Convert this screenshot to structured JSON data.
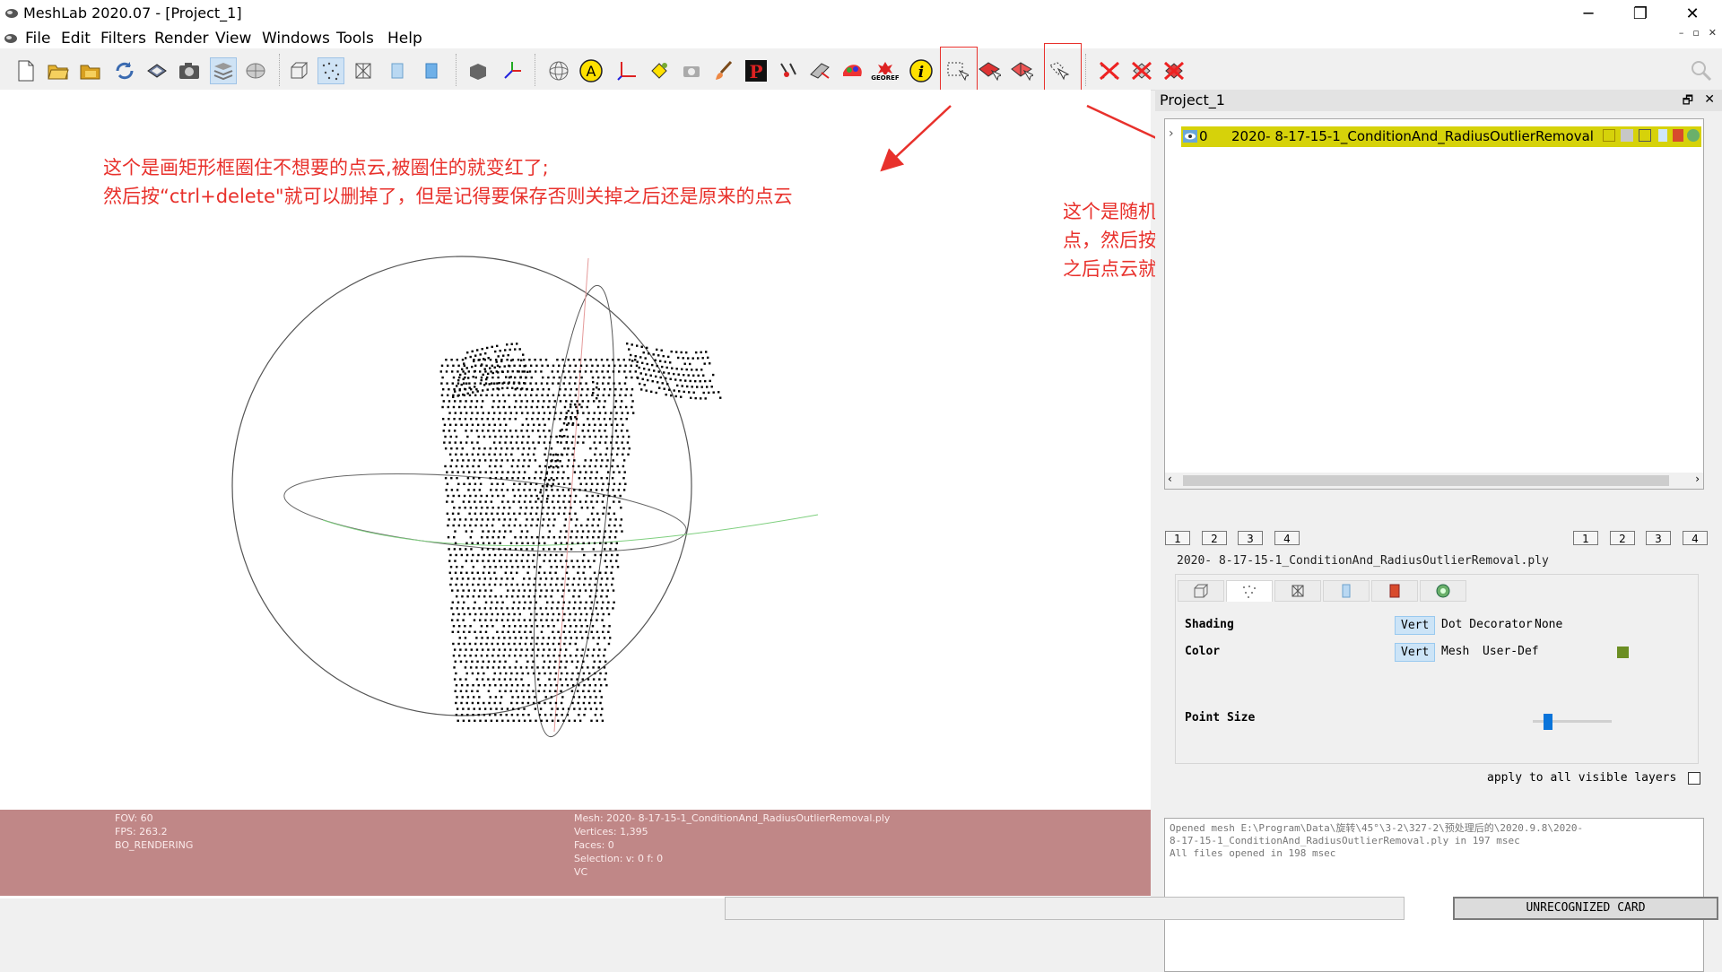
{
  "window": {
    "title": "MeshLab 2020.07 - [Project_1]",
    "minimize_glyph": "─",
    "restore_glyph": "❐",
    "close_glyph": "✕"
  },
  "menu": [
    "File",
    "Edit",
    "Filters",
    "Render",
    "View",
    "Windows",
    "Tools",
    "Help"
  ],
  "mdi_controls": [
    "–",
    "▫",
    "✕"
  ],
  "toolbar": {
    "groups": [
      [
        "new-icon",
        "open-icon",
        "open-project-icon",
        "reload-icon",
        "save-icon",
        "snapshot-icon",
        "layers-icon",
        "mesh-preview-icon"
      ],
      [
        "bbox-icon",
        "points-icon",
        "wireframe-icon",
        "flat-icon",
        "smooth-icon"
      ],
      [
        "decorate-icon",
        "axis-icon"
      ],
      [
        "trackball-icon",
        "annotation-a-icon",
        "measure-axes-icon",
        "paint-bucket-icon",
        "camera-icon",
        "brush-icon",
        "pp-icon",
        "align-icon",
        "manipulator-icon",
        "color-paint-icon",
        "georef-icon",
        "info-icon",
        "select-rect-icon",
        "select-faces-icon",
        "select-connected-icon",
        "select-polygon-icon"
      ],
      [
        "delete-selected-icon",
        "delete-verts-icon",
        "delete-faces-icon"
      ]
    ],
    "active": [
      "layers-icon",
      "points-icon"
    ],
    "highlighted": [
      "select-rect-icon",
      "select-polygon-icon"
    ],
    "georef_label": "GEOREF",
    "a_label": "A",
    "i_label": "i",
    "pp_label": "P"
  },
  "annotations": {
    "left_line1": "这个是画矩形框圈住不想要的点云,被圈住的就变红了;",
    "left_line2": "然后按“ctrl+delete\"就可以删掉了，但是记得要保存否则关掉之后还是原来的点云",
    "right_line1": "这个是随机点几个点，就会画一个多边形，多边形包围住你想操作的",
    "right_line2": "点，然后按“E”键（提示里面写的是invert意思，不太懂），反正按了",
    "right_line3": "之后点云就变红了，然后按”control+delete\"就可以删掉了",
    "color": "#e8312c"
  },
  "viewport_info": {
    "fov": "FOV: 60",
    "fps": "FPS:   263.2",
    "mode": "BO_RENDERING",
    "mesh": "Mesh: 2020- 8-17-15-1_ConditionAnd_RadiusOutlierRemoval.ply",
    "vertices": "Vertices: 1,395",
    "faces": "Faces: 0",
    "selection": "Selection: v: 0 f: 0",
    "vc": "VC"
  },
  "project_panel": {
    "title": "Project_1",
    "float_glyph": "🗗",
    "close_glyph": "✕",
    "expand_glyph": "›",
    "layer": {
      "index": "0",
      "name": "2020- 8-17-15-1_ConditionAnd_RadiusOutlierRemoval",
      "highlight": "#d6d20a"
    },
    "scroll_left": "‹",
    "scroll_right": "›",
    "left_numbers": [
      "1",
      "2",
      "3",
      "4"
    ],
    "right_numbers": [
      "1",
      "2",
      "3",
      "4"
    ],
    "mesh_file": "2020- 8-17-15-1_ConditionAnd_RadiusOutlierRemoval.ply",
    "render_tabs": [
      "bbox-tab-icon",
      "points-tab-icon",
      "wireframe-tab-icon",
      "solid-tab-icon",
      "texture-tab-icon",
      "decorator-tab-icon"
    ],
    "shading_label": "Shading",
    "shading_options": [
      "Vert",
      "Dot Decorator",
      "None"
    ],
    "shading_selected": "Vert",
    "color_label": "Color",
    "color_options": [
      "Vert",
      "Mesh",
      "User-Def"
    ],
    "color_selected": "Vert",
    "user_color": "#6b8e23",
    "point_size_label": "Point Size",
    "point_size_level": 0.15,
    "apply_label": "apply to all visible layers",
    "apply_checked": false
  },
  "log": [
    "Opened mesh E:\\Program\\Data\\旋转\\45°\\3-2\\327-2\\预处理后的\\2020.9.8\\2020-",
    "8-17-15-1_ConditionAnd_RadiusOutlierRemoval.ply in 197 msec",
    "All files opened in 198 msec"
  ],
  "statusbar": {
    "message": "",
    "card": "UNRECOGNIZED CARD"
  }
}
